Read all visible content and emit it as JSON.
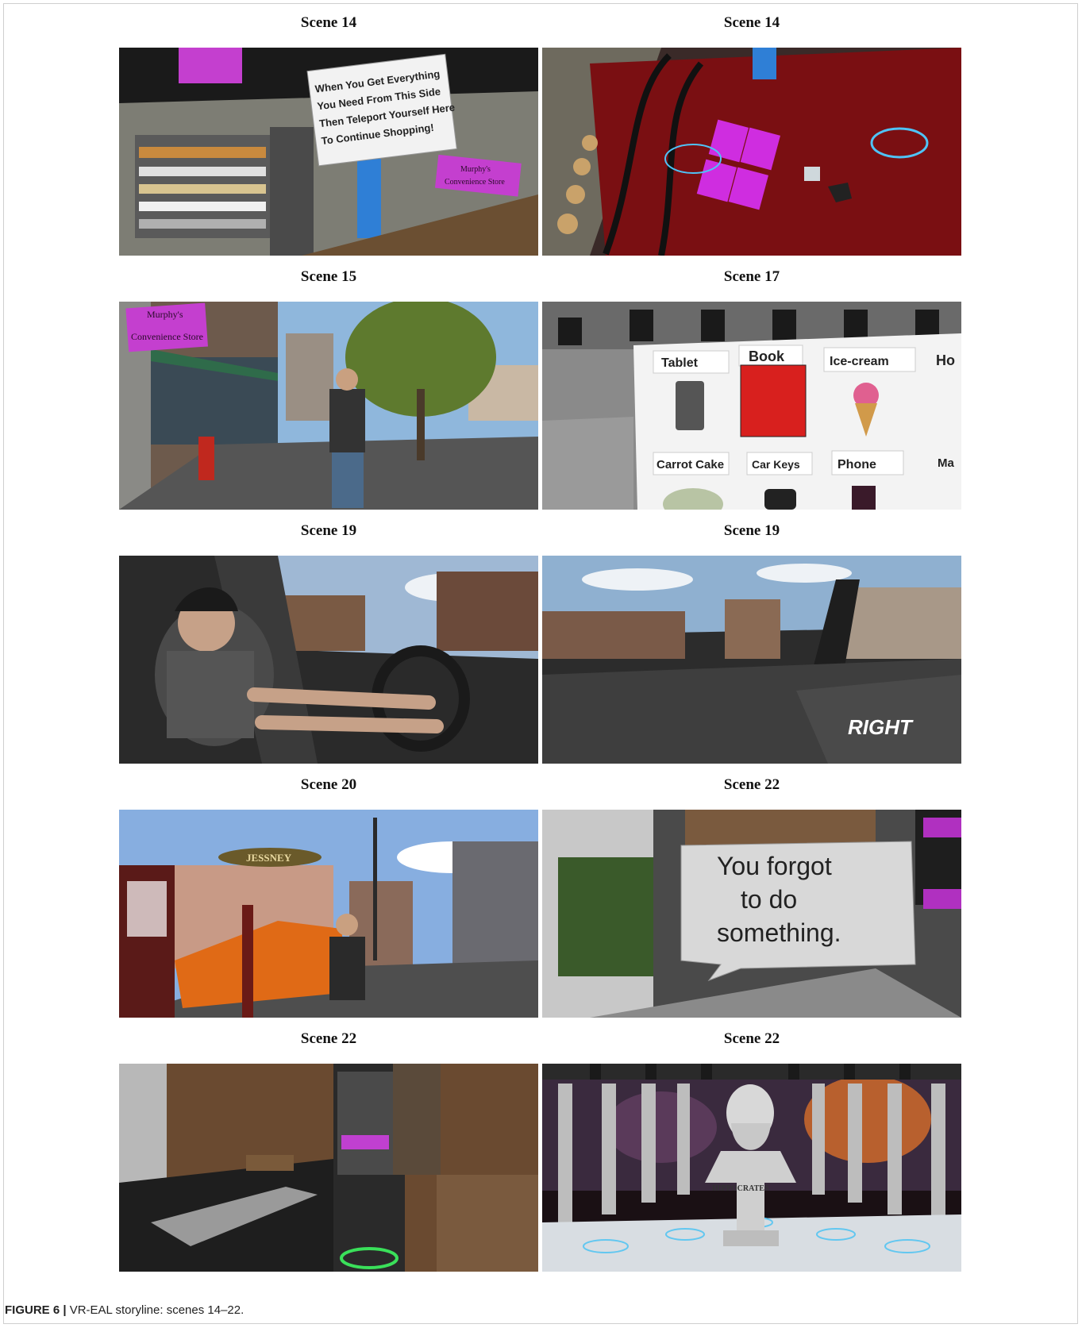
{
  "figure": {
    "panels": [
      {
        "label": "Scene 14",
        "sign_lines": [
          "When You Get Everything",
          "You Need From This Side",
          "Then Teleport Yourself Here",
          "To Continue Shopping!"
        ],
        "store_sign_lines": [
          "Murphy's",
          "Convenience Store"
        ]
      },
      {
        "label": "Scene 14"
      },
      {
        "label": "Scene 15",
        "store_sign_lines": [
          "Murphy's",
          "Convenience Store"
        ]
      },
      {
        "label": "Scene 17",
        "items": [
          "Tablet",
          "Book",
          "Ice-cream",
          "Ho",
          "Carrot Cake",
          "Car Keys",
          "Phone",
          "Ma"
        ]
      },
      {
        "label": "Scene 19"
      },
      {
        "label": "Scene 19",
        "overlay": "RIGHT"
      },
      {
        "label": "Scene 20",
        "shop_sign": "JESSNEY"
      },
      {
        "label": "Scene 22",
        "bubble_lines": [
          "You forgot",
          "to do",
          "something."
        ]
      },
      {
        "label": "Scene 22"
      },
      {
        "label": "Scene 22",
        "bust_label": "HIPPOCRATES"
      }
    ],
    "caption_prefix": "FIGURE 6 |",
    "caption_text": " VR-EAL storyline: scenes 14–22."
  }
}
